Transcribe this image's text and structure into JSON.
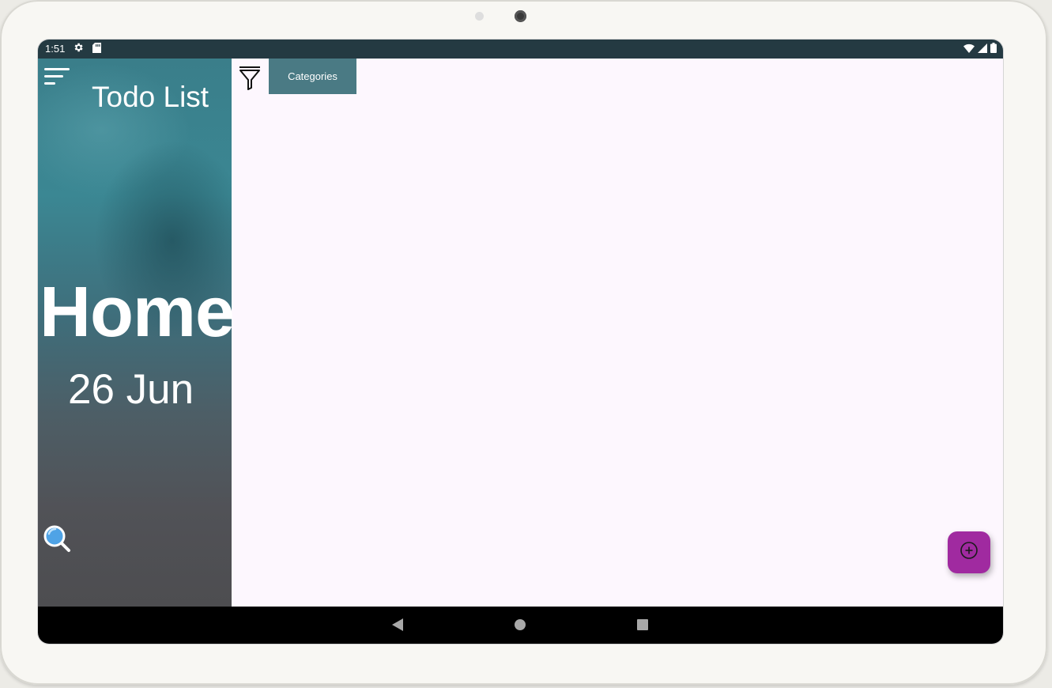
{
  "status_bar": {
    "time": "1:51",
    "icons": [
      "gear-icon",
      "sd-card-icon",
      "wifi-icon",
      "signal-icon",
      "battery-icon"
    ]
  },
  "sidebar": {
    "app_title": "Todo List",
    "section_title": "Home",
    "date": "26 Jun",
    "icons": [
      "menu-icon",
      "search-icon"
    ]
  },
  "toolbar": {
    "filter_icon": "filter-icon",
    "categories_label": "Categories"
  },
  "fab": {
    "icon": "add-circle-icon",
    "color": "#a02aa0"
  },
  "nav_bar": {
    "buttons": [
      "back",
      "home",
      "recents"
    ]
  },
  "colors": {
    "status_bar": "#243a42",
    "categories_button": "#4a7a84",
    "content_background": "#fdf7fe",
    "search_icon_blue": "#4fa3e6"
  }
}
